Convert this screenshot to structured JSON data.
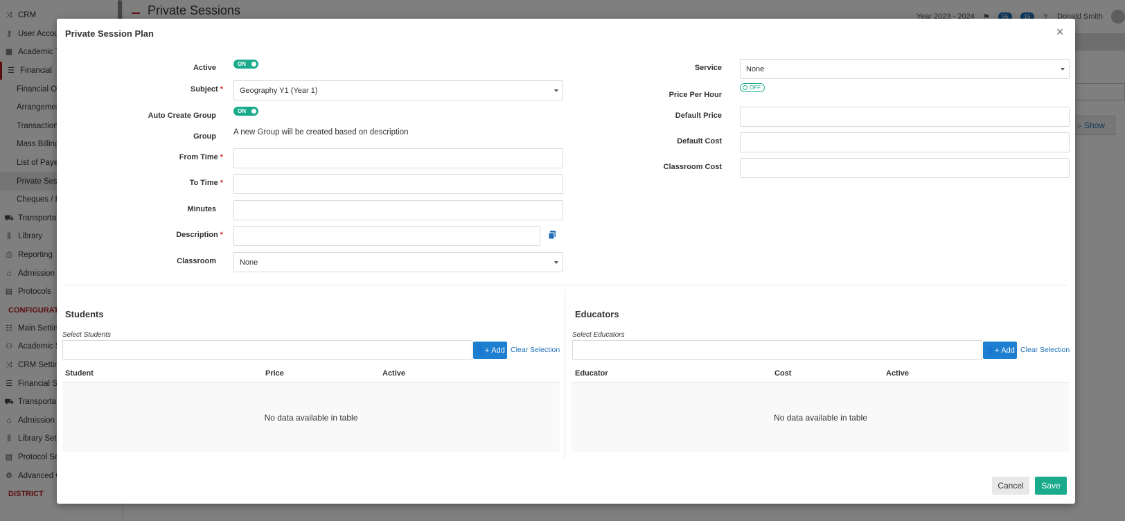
{
  "background": {
    "sidebar": {
      "items": [
        {
          "label": "CRM",
          "icon": "shuffle-icon",
          "type": "item"
        },
        {
          "label": "User Accou",
          "icon": "key-icon",
          "type": "item"
        },
        {
          "label": "Academic T",
          "icon": "grid-icon",
          "type": "item"
        },
        {
          "label": "Financial",
          "icon": "stack-icon",
          "type": "parent"
        },
        {
          "label": "Financial Ov",
          "type": "sub"
        },
        {
          "label": "Arrangemen",
          "type": "sub"
        },
        {
          "label": "Transaction",
          "type": "sub"
        },
        {
          "label": "Mass Billing",
          "type": "sub"
        },
        {
          "label": "List of Paye",
          "type": "sub"
        },
        {
          "label": "Private Sess",
          "type": "sub-active"
        },
        {
          "label": "Cheques / F",
          "type": "sub"
        },
        {
          "label": "Transporta",
          "icon": "bus-icon",
          "type": "item"
        },
        {
          "label": "Library",
          "icon": "books-icon",
          "type": "item"
        },
        {
          "label": "Reporting",
          "icon": "printer-icon",
          "type": "item"
        },
        {
          "label": "Admission",
          "icon": "building-icon",
          "type": "item"
        },
        {
          "label": "Protocols",
          "icon": "protocol-icon",
          "type": "item"
        }
      ],
      "config_section": "CONFIGURATI",
      "config_items": [
        {
          "label": "Main Settin",
          "icon": "sliders-icon"
        },
        {
          "label": "Academic S",
          "icon": "people-icon"
        },
        {
          "label": "CRM Setting",
          "icon": "shuffle-icon"
        },
        {
          "label": "Financial Se",
          "icon": "stack-icon"
        },
        {
          "label": "Transporta",
          "icon": "bus-icon"
        },
        {
          "label": "Admission",
          "icon": "building-icon"
        },
        {
          "label": "Library Sett",
          "icon": "books-icon"
        },
        {
          "label": "Protocol Se",
          "icon": "protocol-icon"
        },
        {
          "label": "Advanced C",
          "icon": "gears-icon"
        }
      ],
      "district_section": "DISTRICT"
    },
    "header": {
      "title": "Private Sessions",
      "year": "Year 2023 - 2024",
      "badge1": "56",
      "badge2": "16",
      "user": "Donald Smith"
    },
    "show_button": "Show"
  },
  "modal": {
    "title": "Private Session Plan",
    "close": "×",
    "left": {
      "active_label": "Active",
      "active_toggle": "ON",
      "subject_label": "Subject",
      "subject_value": "Geography Y1 (Year 1)",
      "auto_group_label": "Auto Create Group",
      "auto_group_toggle": "ON",
      "group_label": "Group",
      "group_text": "A new Group will be created based on description",
      "from_time_label": "From Time",
      "to_time_label": "To Time",
      "minutes_label": "Minutes",
      "description_label": "Description",
      "classroom_label": "Classroom",
      "classroom_value": "None",
      "required_mark": "*"
    },
    "right": {
      "service_label": "Service",
      "service_value": "None",
      "price_per_hour_label": "Price Per Hour",
      "price_per_hour_toggle": "OFF",
      "default_price_label": "Default Price",
      "default_cost_label": "Default Cost",
      "classroom_cost_label": "Classroom Cost"
    },
    "students": {
      "title": "Students",
      "select_caption": "Select Students",
      "add_label": "Add",
      "clear_label": "Clear Selection",
      "columns": [
        "Student",
        "Price",
        "Active"
      ],
      "empty_text": "No data available in table"
    },
    "educators": {
      "title": "Educators",
      "select_caption": "Select Educators",
      "add_label": "Add",
      "clear_label": "Clear Selection",
      "columns": [
        "Educator",
        "Cost",
        "Active"
      ],
      "empty_text": "No data available in table"
    },
    "footer": {
      "cancel_label": "Cancel",
      "save_label": "Save"
    }
  },
  "colors": {
    "accent_teal": "#1aaa8c",
    "accent_blue": "#1e7fd0",
    "required_red": "#d32f2f"
  }
}
